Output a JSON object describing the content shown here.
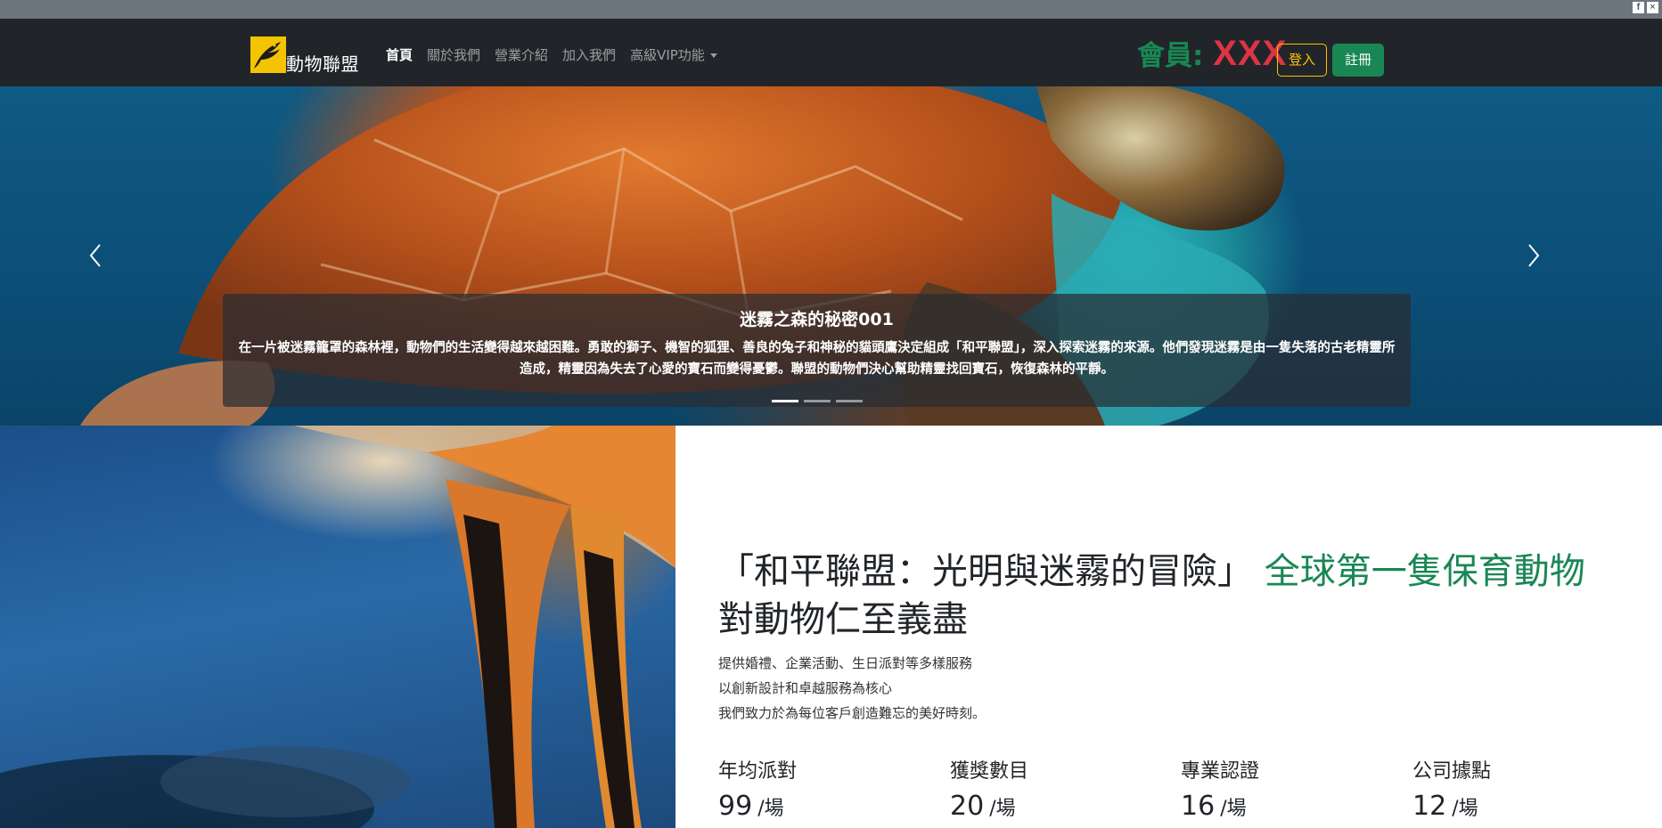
{
  "social": {
    "facebook": "f",
    "close": "×"
  },
  "navbar": {
    "brand": "動物聯盟",
    "links": [
      {
        "label": "首頁",
        "active": true
      },
      {
        "label": "關於我們",
        "active": false
      },
      {
        "label": "營業介紹",
        "active": false
      },
      {
        "label": "加入我們",
        "active": false
      },
      {
        "label": "高級VIP功能",
        "active": false,
        "dropdown": true
      }
    ],
    "member_label": "會員:",
    "member_name": "XXX",
    "login_label": "登入",
    "register_label": "註冊",
    "colors": {
      "member_label": "#198754",
      "member_name": "#dc3545",
      "login": "#ffc107",
      "register": "#198754"
    }
  },
  "hero": {
    "caption_title": "迷霧之森的秘密001",
    "caption_text": "在一片被迷霧籠罩的森林裡，動物們的生活變得越來越困難。勇敢的獅子、機智的狐狸、善良的兔子和神秘的貓頭鷹決定組成「和平聯盟」，深入探索迷霧的來源。他們發現迷霧是由一隻失落的古老精靈所造成，精靈因為失去了心愛的寶石而變得憂鬱。聯盟的動物們決心幫助精靈找回寶石，恢復森林的平靜。",
    "slides_total": 3,
    "active_slide": 1,
    "prev_icon": "chevron-left-icon",
    "next_icon": "chevron-right-icon"
  },
  "intro": {
    "headline_main": "「和平聯盟：光明與迷霧的冒險」",
    "headline_accent": "全球第一隻保育動物",
    "headline_sub": "對動物仁至義盡",
    "lines": [
      "提供婚禮、企業活動、生日派對等多樣服務",
      "以創新設計和卓越服務為核心",
      "我們致力於為每位客戶創造難忘的美好時刻。"
    ],
    "accent_color": "#198754"
  },
  "stats": [
    {
      "label": "年均派對",
      "value": "99",
      "unit": "/場"
    },
    {
      "label": "獲獎數目",
      "value": "20",
      "unit": "/場"
    },
    {
      "label": "專業認證",
      "value": "16",
      "unit": "/場"
    },
    {
      "label": "公司據點",
      "value": "12",
      "unit": "/場"
    }
  ]
}
